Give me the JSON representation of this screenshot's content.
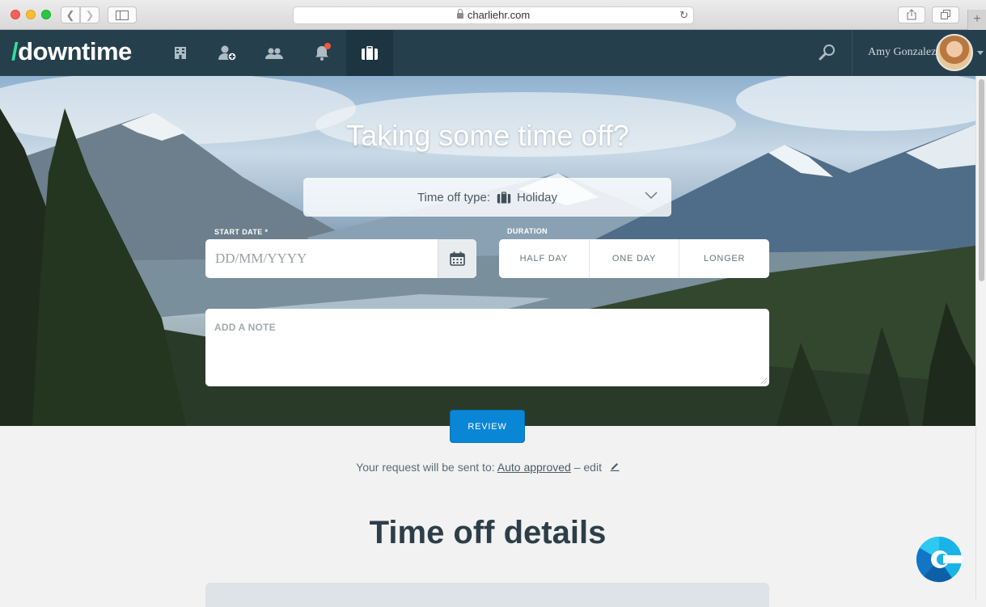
{
  "browser": {
    "url": "charliehr.com"
  },
  "nav": {
    "logo_slash": "/",
    "logo_text": "downtime",
    "icons": [
      "building-icon",
      "add-person-icon",
      "people-icon",
      "bell-icon",
      "suitcase-icon"
    ],
    "active_icon": "suitcase-icon",
    "user_name": "Amy Gonzalez"
  },
  "hero": {
    "title": "Taking some time off?",
    "type_label": "Time off type:",
    "type_value": "Holiday",
    "start_date_label": "START DATE *",
    "start_date_placeholder": "DD/MM/YYYY",
    "duration_label": "DURATION",
    "duration_options": [
      "HALF DAY",
      "ONE DAY",
      "LONGER"
    ],
    "note_placeholder": "ADD A NOTE"
  },
  "actions": {
    "review_label": "REVIEW"
  },
  "request": {
    "prefix": "Your request will be sent to:",
    "approver": "Auto approved",
    "suffix": "– edit"
  },
  "details": {
    "title": "Time off details"
  },
  "colors": {
    "nav_bg": "#263f4c",
    "logo_accent": "#2fe0a0",
    "primary_button": "#0a86d6",
    "notification_dot": "#f05a3a"
  }
}
